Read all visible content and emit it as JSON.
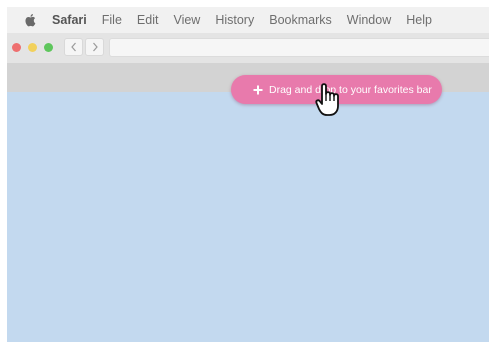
{
  "menubar": {
    "apple_icon": "apple-logo-icon",
    "items": [
      "Safari",
      "File",
      "Edit",
      "View",
      "History",
      "Bookmarks",
      "Window",
      "Help"
    ]
  },
  "toolbar": {
    "traffic_lights": {
      "close": "#ee6f6f",
      "minimize": "#f2d15c",
      "zoom": "#5ec65c"
    },
    "back_icon": "chevron-left-icon",
    "forward_icon": "chevron-right-icon",
    "address_value": ""
  },
  "favorites_bar": {
    "drag_pill_label": "Drag and drop to your favorites bar",
    "drag_pill_icon": "move-cross-icon",
    "drag_pill_color": "#e87aac"
  },
  "content": {
    "background": "#c3d9ef"
  },
  "cursor": {
    "icon": "hand-grab-cursor-icon"
  }
}
